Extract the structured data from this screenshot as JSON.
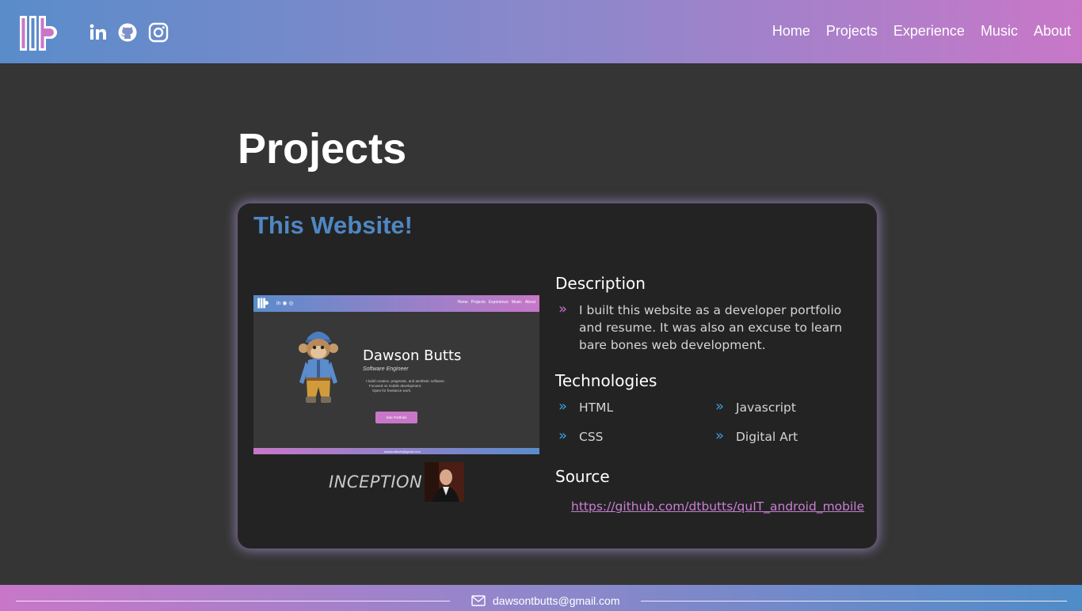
{
  "header": {
    "social": [
      {
        "icon": "linkedin-icon"
      },
      {
        "icon": "github-icon"
      },
      {
        "icon": "instagram-icon"
      }
    ],
    "nav": [
      "Home",
      "Projects",
      "Experience",
      "Music",
      "About"
    ]
  },
  "main": {
    "title": "Projects",
    "project": {
      "title": "This Website!",
      "screenshot": {
        "nav": [
          "Home",
          "Projects",
          "Experience",
          "Music",
          "About"
        ],
        "name": "Dawson Butts",
        "role": "Software Engineer",
        "lines": [
          "I build creative, pragmatic, and aesthetic software.",
          "Focused on mobile development.",
          "Open for freelance work."
        ],
        "button": "See Portfolio",
        "email": "dawsontbutts@gmail.com"
      },
      "caption": "INCEPTION",
      "description_heading": "Description",
      "description": "I built this website as a developer portfolio and resume. It was also an excuse to learn bare bones web development.",
      "technologies_heading": "Technologies",
      "technologies": [
        "HTML",
        "Javascript",
        "CSS",
        "Digital Art"
      ],
      "source_heading": "Source",
      "source_link": "https://github.com/dtbutts/quIT_android_mobile"
    }
  },
  "footer": {
    "email": "dawsontbutts@gmail.com"
  },
  "colors": {
    "header_gradient": [
      "#5a8cca",
      "#c877c8"
    ],
    "accent_blue": "#4f87c2",
    "accent_pink": "#c87fd2",
    "bullet_blue": "#3aa0e6",
    "bullet_pink": "#c877c8",
    "background": "#353535",
    "card": "#232323"
  }
}
